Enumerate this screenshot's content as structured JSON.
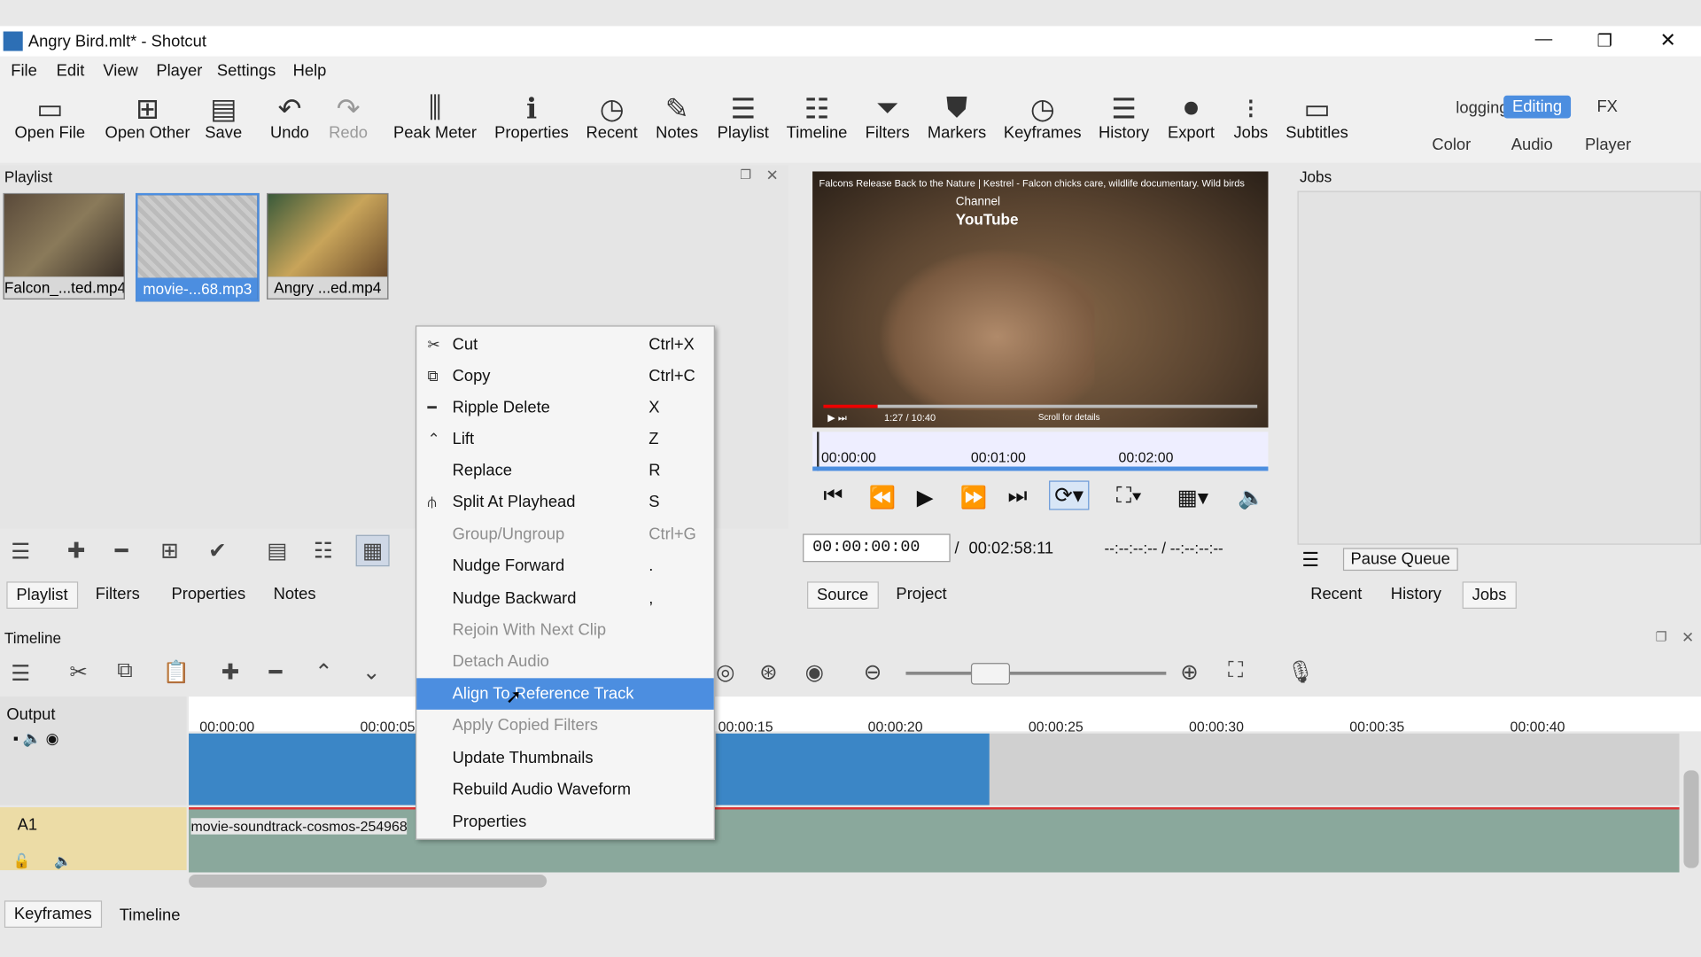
{
  "window": {
    "title": "Angry Bird.mlt* - Shotcut",
    "min": "—",
    "restore": "❐",
    "close": "✕"
  },
  "menu": [
    "File",
    "Edit",
    "View",
    "Player",
    "Settings",
    "Help"
  ],
  "toolbar": [
    {
      "label": "Open File",
      "icon": "open-file-icon"
    },
    {
      "label": "Open Other",
      "icon": "open-other-icon"
    },
    {
      "label": "Save",
      "icon": "save-icon"
    },
    {
      "label": "Undo",
      "icon": "undo-icon"
    },
    {
      "label": "Redo",
      "icon": "redo-icon"
    },
    {
      "label": "Peak Meter",
      "icon": "peak-meter-icon"
    },
    {
      "label": "Properties",
      "icon": "properties-icon"
    },
    {
      "label": "Recent",
      "icon": "recent-icon"
    },
    {
      "label": "Notes",
      "icon": "notes-icon"
    },
    {
      "label": "Playlist",
      "icon": "playlist-icon"
    },
    {
      "label": "Timeline",
      "icon": "timeline-icon"
    },
    {
      "label": "Filters",
      "icon": "filters-icon"
    },
    {
      "label": "Markers",
      "icon": "markers-icon"
    },
    {
      "label": "Keyframes",
      "icon": "keyframes-icon"
    },
    {
      "label": "History",
      "icon": "history-icon"
    },
    {
      "label": "Export",
      "icon": "export-icon"
    },
    {
      "label": "Jobs",
      "icon": "jobs-icon"
    },
    {
      "label": "Subtitles",
      "icon": "subtitles-icon"
    }
  ],
  "layouts": {
    "logging": "logging",
    "editing": "Editing",
    "fx": "FX",
    "color": "Color",
    "audio": "Audio",
    "player": "Player"
  },
  "playlist": {
    "title": "Playlist",
    "clips": [
      "Falcon_...ted.mp4",
      "movie-...68.mp3",
      "Angry ...ed.mp4"
    ],
    "tabs": [
      "Playlist",
      "Filters",
      "Properties",
      "Notes"
    ]
  },
  "context_menu": [
    {
      "label": "Cut",
      "shortcut": "Ctrl+X",
      "icon": "cut-icon",
      "disabled": false
    },
    {
      "label": "Copy",
      "shortcut": "Ctrl+C",
      "icon": "copy-icon",
      "disabled": false
    },
    {
      "label": "Ripple Delete",
      "shortcut": "X",
      "icon": "ripple-delete-icon",
      "disabled": false
    },
    {
      "label": "Lift",
      "shortcut": "Z",
      "icon": "lift-icon",
      "disabled": false
    },
    {
      "label": "Replace",
      "shortcut": "R",
      "icon": "",
      "disabled": false
    },
    {
      "label": "Split At Playhead",
      "shortcut": "S",
      "icon": "split-icon",
      "disabled": false
    },
    {
      "label": "Group/Ungroup",
      "shortcut": "Ctrl+G",
      "icon": "",
      "disabled": true
    },
    {
      "label": "Nudge Forward",
      "shortcut": ".",
      "icon": "",
      "disabled": false
    },
    {
      "label": "Nudge Backward",
      "shortcut": ",",
      "icon": "",
      "disabled": false
    },
    {
      "label": "Rejoin With Next Clip",
      "shortcut": "",
      "icon": "",
      "disabled": true
    },
    {
      "label": "Detach Audio",
      "shortcut": "",
      "icon": "",
      "disabled": true
    },
    {
      "label": "Align To Reference Track",
      "shortcut": "",
      "icon": "",
      "disabled": false,
      "highlighted": true
    },
    {
      "label": "Apply Copied Filters",
      "shortcut": "",
      "icon": "",
      "disabled": true
    },
    {
      "label": "Update Thumbnails",
      "shortcut": "",
      "icon": "",
      "disabled": false
    },
    {
      "label": "Rebuild Audio Waveform",
      "shortcut": "",
      "icon": "",
      "disabled": false
    },
    {
      "label": "Properties",
      "shortcut": "",
      "icon": "",
      "disabled": false
    }
  ],
  "player": {
    "video_caption": "Falcons Release Back to the Nature | Kestrel - Falcon chicks care, wildlife documentary. Wild birds",
    "overlay_channel": "Channel",
    "overlay_brand": "YouTube",
    "overlay_time": "1:27 / 10:40",
    "overlay_scroll": "Scroll for details",
    "ruler": [
      "00:00:00",
      "00:01:00",
      "00:02:00"
    ],
    "timecode": "00:00:00:00",
    "separator": "/",
    "duration": "00:02:58:11",
    "inout": "--:--:--:-- / --:--:--:--",
    "source_tab": "Source",
    "project_tab": "Project"
  },
  "jobs": {
    "title": "Jobs",
    "pause_queue": "Pause Queue",
    "tabs": [
      "Recent",
      "History",
      "Jobs"
    ]
  },
  "timeline": {
    "title": "Timeline",
    "ruler": [
      "00:00:00",
      "00:00:05",
      "00:00:15",
      "00:00:20",
      "00:00:25",
      "00:00:30",
      "00:00:35",
      "00:00:40"
    ],
    "tracks": [
      {
        "name": "Output"
      },
      {
        "name": "A1"
      }
    ],
    "audio_clip": "movie-soundtrack-cosmos-254968"
  },
  "bottom_tabs": [
    "Keyframes",
    "Timeline"
  ],
  "colors": {
    "highlight": "#4c8ee0",
    "clip_blue": "#3b86c6",
    "audio_green": "#8aa89c"
  }
}
